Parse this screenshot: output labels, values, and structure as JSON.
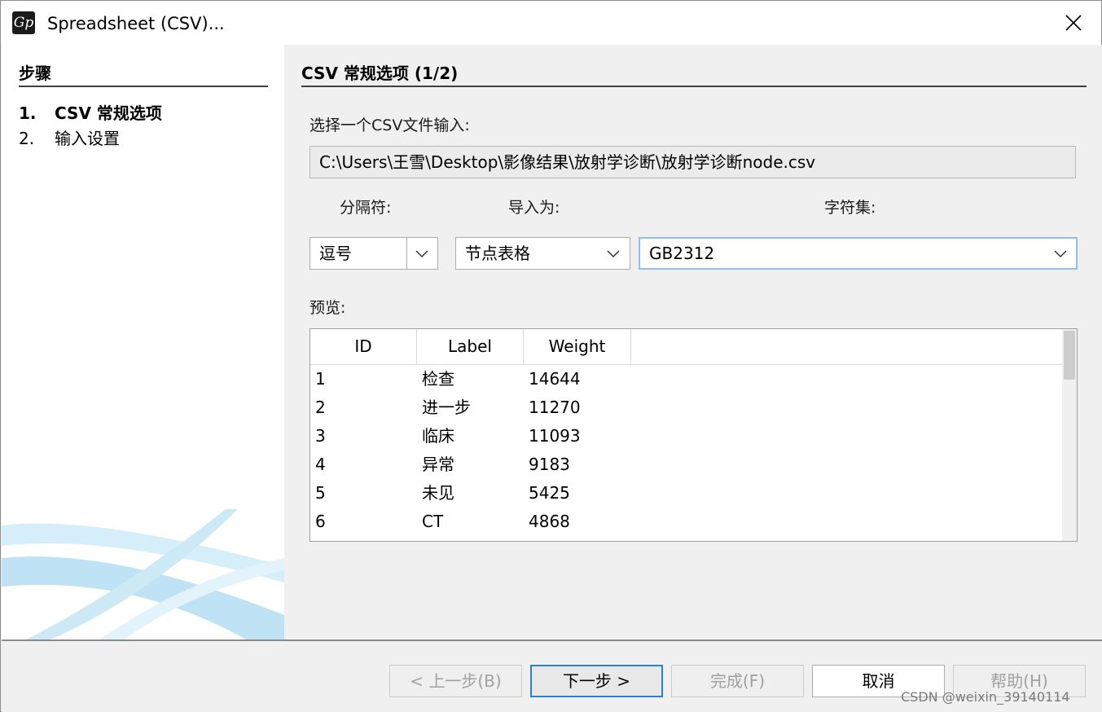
{
  "window": {
    "title": "Spreadsheet (CSV)...",
    "app_icon_glyph": "Gp"
  },
  "sidebar": {
    "title": "步骤",
    "steps": [
      {
        "num": "1.",
        "label": "CSV 常规选项"
      },
      {
        "num": "2.",
        "label": "输入设置"
      }
    ]
  },
  "main": {
    "section_title": "CSV 常规选项 (1/2)",
    "file_prompt": "选择一个CSV文件输入:",
    "file_path": "C:\\Users\\王雪\\Desktop\\影像结果\\放射学诊断\\放射学诊断node.csv",
    "separator_label": "分隔符:",
    "separator_value": "逗号",
    "import_as_label": "导入为:",
    "import_as_value": "节点表格",
    "charset_label": "字符集:",
    "charset_value": "GB2312",
    "preview_label": "预览:",
    "preview": {
      "columns": [
        "ID",
        "Label",
        "Weight"
      ],
      "rows": [
        [
          "1",
          "检查",
          "14644"
        ],
        [
          "2",
          "进一步",
          "11270"
        ],
        [
          "3",
          "临床",
          "11093"
        ],
        [
          "4",
          "异常",
          "9183"
        ],
        [
          "5",
          "未见",
          "5425"
        ],
        [
          "6",
          "CT",
          "4868"
        ]
      ]
    }
  },
  "footer": {
    "prev": "< 上一步(B)",
    "next": "下一步 >",
    "finish": "完成(F)",
    "cancel": "取消",
    "help": "帮助(H)"
  },
  "watermark": "CSDN @weixin_39140114",
  "colors": {
    "focus_border": "#93bde6",
    "default_button_border": "#2f7fd0",
    "disabled_text": "#a0a0a0",
    "decor_blue": "#bfe3f4"
  }
}
